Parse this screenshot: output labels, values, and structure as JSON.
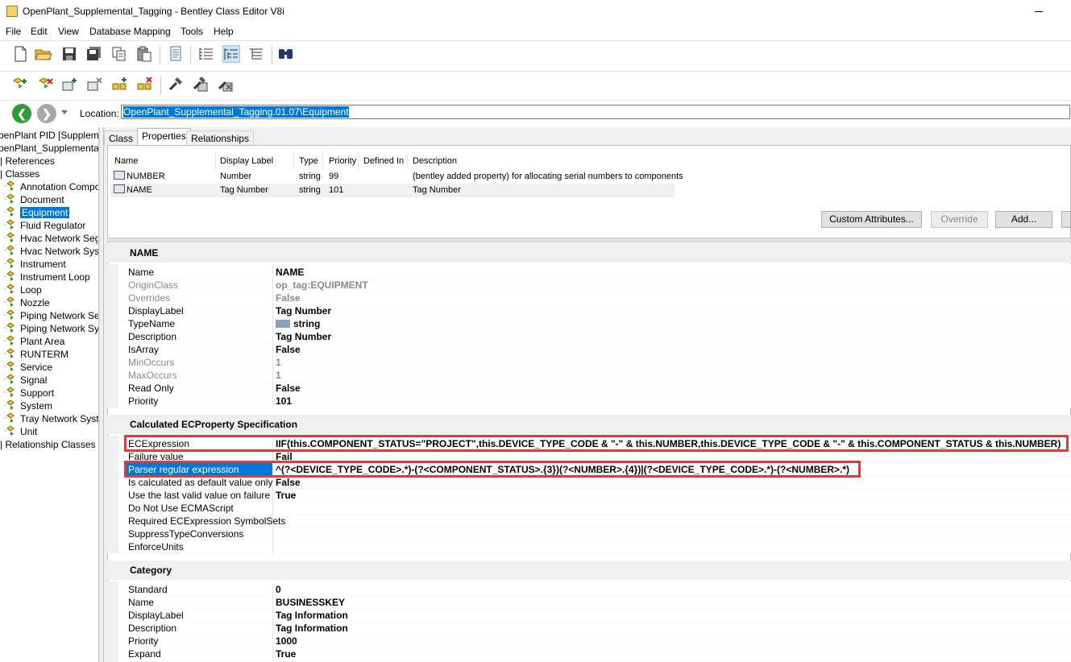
{
  "window": {
    "title": "OpenPlant_Supplemental_Tagging - Bentley Class Editor V8i"
  },
  "menu": [
    "File",
    "Edit",
    "View",
    "Database Mapping",
    "Tools",
    "Help"
  ],
  "location": {
    "label": "Location:",
    "value": "OpenPlant_Supplemental_Tagging.01.07\\Equipment"
  },
  "tree": {
    "root1": "penPlant PID [Supplemen",
    "root2": "penPlant_Supplemental_T",
    "references": "References",
    "classes": "Classes",
    "items": [
      "Annotation Compon",
      "Document",
      "Equipment",
      "Fluid Regulator",
      "Hvac Network Seg",
      "Hvac Network Syst",
      "Instrument",
      "Instrument Loop",
      "Loop",
      "Nozzle",
      "Piping Network Seg",
      "Piping Network Sys",
      "Plant Area",
      "RUNTERM",
      "Service",
      "Signal",
      "Support",
      "System",
      "Tray Network Syste",
      "Unit"
    ],
    "selected_item": "Equipment",
    "relationship_classes": "Relationship Classes"
  },
  "tabs": [
    "Class",
    "Properties",
    "Relationships"
  ],
  "active_tab": "Properties",
  "property_list": {
    "columns": [
      "Name",
      "Display Label",
      "Type",
      "Priority",
      "Defined In",
      "Description"
    ],
    "rows": [
      {
        "name": "NUMBER",
        "label": "Number",
        "type": "string",
        "priority": "99",
        "defined_in": "",
        "description": "(bentley added property) for allocating serial numbers to components"
      },
      {
        "name": "NAME",
        "label": "Tag Number",
        "type": "string",
        "priority": "101",
        "defined_in": "",
        "description": "Tag Number"
      }
    ]
  },
  "buttons": {
    "custom_attributes": "Custom Attributes...",
    "override": "Override",
    "add": "Add..."
  },
  "sections": {
    "name": {
      "title": "NAME",
      "rows": [
        {
          "k": "Name",
          "v": "NAME"
        },
        {
          "k": "OriginClass",
          "v": "op_tag:EQUIPMENT"
        },
        {
          "k": "Overrides",
          "v": "False"
        },
        {
          "k": "DisplayLabel",
          "v": "Tag Number"
        },
        {
          "k": "TypeName",
          "v": "string"
        },
        {
          "k": "Description",
          "v": "Tag Number"
        },
        {
          "k": "IsArray",
          "v": "False"
        },
        {
          "k": "MinOccurs",
          "v": "1"
        },
        {
          "k": "MaxOccurs",
          "v": "1"
        },
        {
          "k": "Read Only",
          "v": "False"
        },
        {
          "k": "Priority",
          "v": "101"
        }
      ]
    },
    "calc": {
      "title": "Calculated ECProperty Specification",
      "rows": [
        {
          "k": "ECExpression",
          "v": "IIF(this.COMPONENT_STATUS=\"PROJECT\",this.DEVICE_TYPE_CODE & \"-\" & this.NUMBER,this.DEVICE_TYPE_CODE & \"-\" & this.COMPONENT_STATUS & this.NUMBER)"
        },
        {
          "k": "Failure value",
          "v": "Fail"
        },
        {
          "k": "Parser regular expression",
          "v": "^(?<DEVICE_TYPE_CODE>.*)-(?<COMPONENT_STATUS>.{3})(?<NUMBER>.{4})|(?<DEVICE_TYPE_CODE>.*)-(?<NUMBER>.*)"
        },
        {
          "k": "Is calculated as default value only",
          "v": "False"
        },
        {
          "k": "Use the last valid value on failure",
          "v": "True"
        },
        {
          "k": "Do Not Use ECMAScript",
          "v": ""
        },
        {
          "k": "Required ECExpression SymbolSets",
          "v": ""
        },
        {
          "k": "SuppressTypeConversions",
          "v": ""
        },
        {
          "k": "EnforceUnits",
          "v": ""
        }
      ]
    },
    "category": {
      "title": "Category",
      "rows": [
        {
          "k": "Standard",
          "v": "0"
        },
        {
          "k": "Name",
          "v": "BUSINESSKEY"
        },
        {
          "k": "DisplayLabel",
          "v": "Tag Information"
        },
        {
          "k": "Description",
          "v": "Tag Information"
        },
        {
          "k": "Priority",
          "v": "1000"
        },
        {
          "k": "Expand",
          "v": "True"
        }
      ]
    }
  }
}
